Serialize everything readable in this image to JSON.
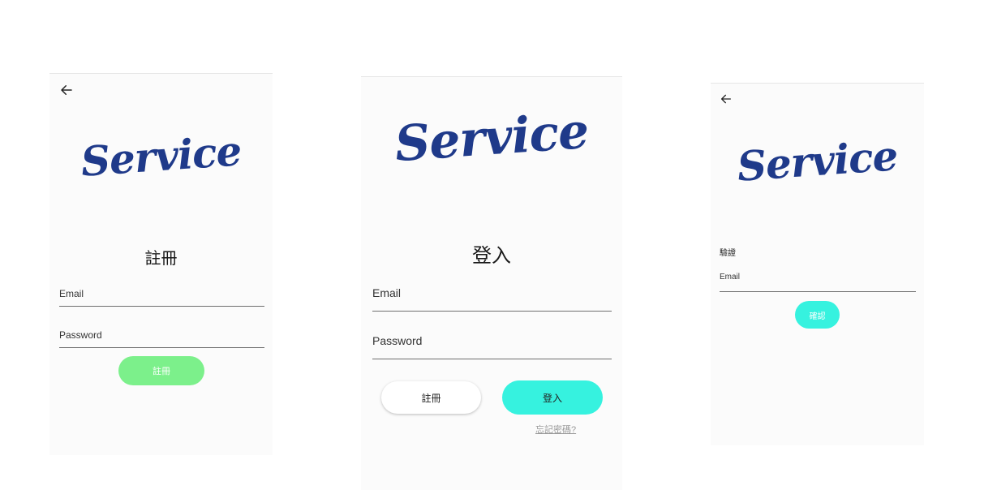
{
  "register": {
    "logo": "Service",
    "title": "註冊",
    "email_placeholder": "Email",
    "password_placeholder": "Password",
    "submit_label": "註冊",
    "submit_color": "#7cf08b",
    "back_icon": "arrow-left-icon"
  },
  "login": {
    "logo": "Service",
    "title": "登入",
    "email_placeholder": "Email",
    "password_placeholder": "Password",
    "register_label": "註冊",
    "login_label": "登入",
    "login_color": "#36f2df",
    "forgot_label": "忘記密碼?"
  },
  "verify": {
    "logo": "Service",
    "title": "驗證",
    "email_placeholder": "Email",
    "confirm_label": "確認",
    "confirm_color": "#36f2df",
    "back_icon": "arrow-left-icon"
  }
}
